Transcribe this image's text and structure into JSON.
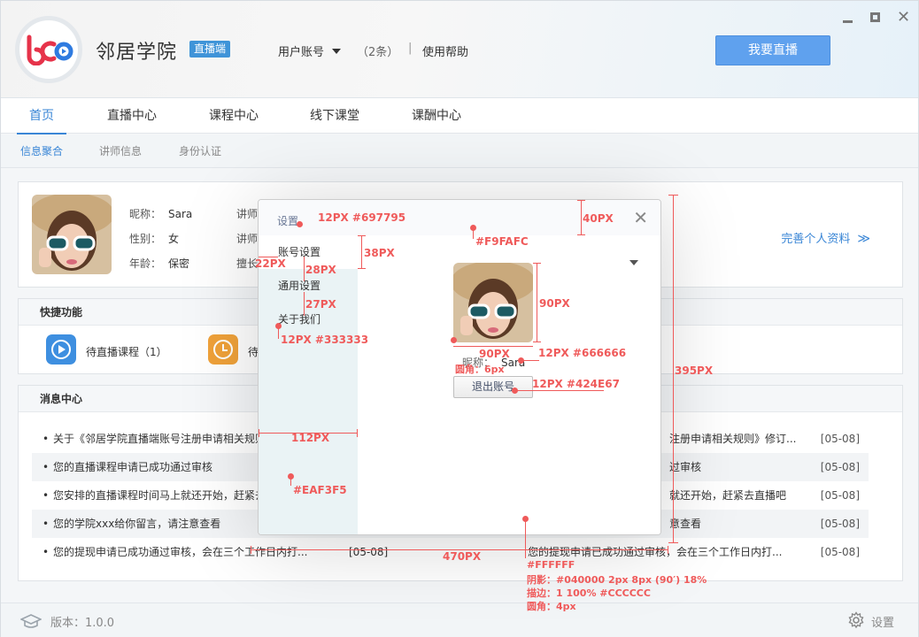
{
  "app": {
    "title": "邻居学院",
    "badge": "直播端",
    "account_label": "用户账号",
    "account_count": "（2条）",
    "separator": "|",
    "help": "使用帮助",
    "go_live": "我要直播",
    "brand_colors": {
      "logo_red": "#e6334a",
      "logo_blue": "#2f7be0",
      "accent": "#3a86d6",
      "button": "#5fa1ee"
    }
  },
  "window_controls": {
    "minimize_icon": "minimize-icon",
    "maximize_icon": "maximize-icon",
    "close_icon": "close-icon",
    "close_glyph": "✕"
  },
  "main_tabs": [
    "首页",
    "直播中心",
    "课程中心",
    "线下课堂",
    "课酬中心"
  ],
  "sub_tabs": [
    "信息聚合",
    "讲师信息",
    "身份认证"
  ],
  "profile": {
    "nickname_label": "昵称：",
    "nickname": "Sara",
    "gender_label": "性别：",
    "gender": "女",
    "age_label": "年龄：",
    "age": "保密",
    "col2_row1": "讲师",
    "col2_row2": "讲师",
    "col2_row3": "擅长",
    "complete_link": "完善个人资料",
    "complete_chevron": "≫"
  },
  "quick": {
    "title": "快捷功能",
    "item1": "待直播课程（1）",
    "item2": "待"
  },
  "messages": {
    "title": "消息中心",
    "rows": [
      {
        "left": "关于《邻居学院直播端账号注册申请相关规则",
        "right": "注册申请相关规则》修订...",
        "date": "[05-08]"
      },
      {
        "left": "您的直播课程申请已成功通过审核",
        "right": "过审核",
        "date": "[05-08]"
      },
      {
        "left": "您安排的直播课程时间马上就还开始，赶紧去",
        "right": "就还开始，赶紧去直播吧",
        "date": "[05-08]"
      },
      {
        "left": "您的学院xxx给你留言，请注意查看",
        "right": "意查看",
        "date": "[05-08]"
      },
      {
        "left": "您的提现申请已成功通过审核，会在三个工作日内打...",
        "mid_date": "[05-08]",
        "right": "您的提现申请已成功通过审核，会在三个工作日内打...",
        "date": "[05-08]"
      }
    ]
  },
  "footer": {
    "version": "版本：1.0.0",
    "settings": "设置"
  },
  "dialog": {
    "title": "设置",
    "close": "✕",
    "menu": [
      "账号设置",
      "通用设置",
      "关于我们"
    ],
    "nickname_label": "昵称：",
    "nickname": "Sara",
    "logout": "退出账号"
  },
  "annotations": {
    "title_spec": "12PX #697795",
    "titlebar_height": "40PX",
    "titlebar_color": "#F9FAFC",
    "item_height": "38PX",
    "left_pad": "22PX",
    "first_gap": "28PX",
    "second_gap": "27PX",
    "menu_font": "12PX #333333",
    "side_width": "112PX",
    "side_color": "#EAF3F5",
    "avatar_h": "90PX",
    "avatar_w": "90PX",
    "avatar_radius": "圆角：6px",
    "nick_font": "12PX #666666",
    "btn_font": "12PX #424E67",
    "dialog_height": "395PX",
    "dialog_width": "470PX",
    "dialog_bg": "#FFFFFF",
    "shadow": "阴影：#040000 2px 8px (90′) 18%",
    "border": "描边：1 100% #CCCCCC",
    "radius": "圆角：4px"
  }
}
